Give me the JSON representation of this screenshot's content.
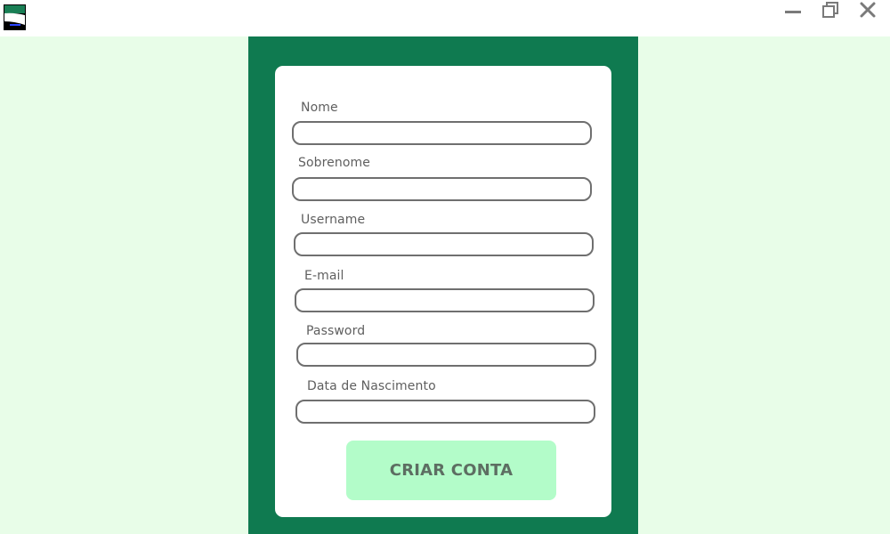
{
  "window": {
    "logo_icon": "app-flag-logo-icon",
    "controls": {
      "minimize_icon": "minimize-icon",
      "maximize_icon": "maximize-icon",
      "close_icon": "close-icon"
    }
  },
  "colors": {
    "page_background": "#e8fde8",
    "panel_green": "#0f7a50",
    "card_background": "#ffffff",
    "button_background": "#b3fcc9",
    "button_text": "#5d6e62",
    "input_border": "#6f6f6f",
    "label_text": "#5f5f5f"
  },
  "form": {
    "fields": [
      {
        "label": "Nome",
        "value": ""
      },
      {
        "label": "Sobrenome",
        "value": ""
      },
      {
        "label": "Username",
        "value": ""
      },
      {
        "label": "E-mail",
        "value": ""
      },
      {
        "label": "Password",
        "value": ""
      },
      {
        "label": "Data de Nascimento",
        "value": ""
      }
    ],
    "submit_label": "CRIAR CONTA"
  }
}
